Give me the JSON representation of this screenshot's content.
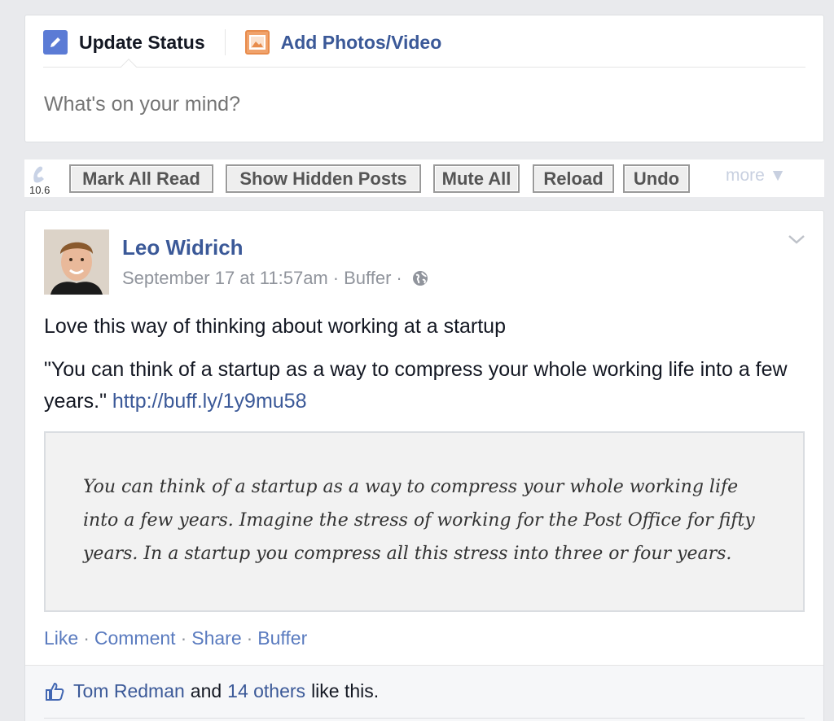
{
  "composer": {
    "tab_status": "Update Status",
    "tab_photo": "Add Photos/Video",
    "placeholder": "What's on your mind?"
  },
  "toolbar": {
    "version": "10.6",
    "buttons": [
      "Mark All Read",
      "Show Hidden Posts",
      "Mute All",
      "Reload",
      "Undo"
    ],
    "more": "more ▼"
  },
  "post": {
    "author": "Leo Widrich",
    "timestamp": "September 17 at 11:57am",
    "via": "Buffer",
    "text": "Love this way of thinking about working at a startup",
    "quote": "\"You can think of a startup as a way to compress your whole working life into a few years.\"",
    "link": "http://buff.ly/1y9mu58",
    "attachment_text": "You can think of a startup as a way to compress your whole working life into a few years. Imagine the stress of working for the Post Office for fifty years. In a startup you compress all this stress into three or four years.",
    "actions": [
      "Like",
      "Comment",
      "Share",
      "Buffer"
    ],
    "likes": {
      "first_name": "Tom Redman",
      "and": "and",
      "others": "14 others",
      "suffix": "like this."
    }
  },
  "colors": {
    "link": "#3b5998",
    "background": "#e9eaed",
    "muted": "#90949c"
  },
  "icons": {
    "status": "pencil-icon",
    "photo": "photo-icon",
    "privacy": "globe-icon",
    "menu": "chevron-down-icon",
    "like": "thumbs-up-icon",
    "toolbar": "extension-logo-icon"
  }
}
